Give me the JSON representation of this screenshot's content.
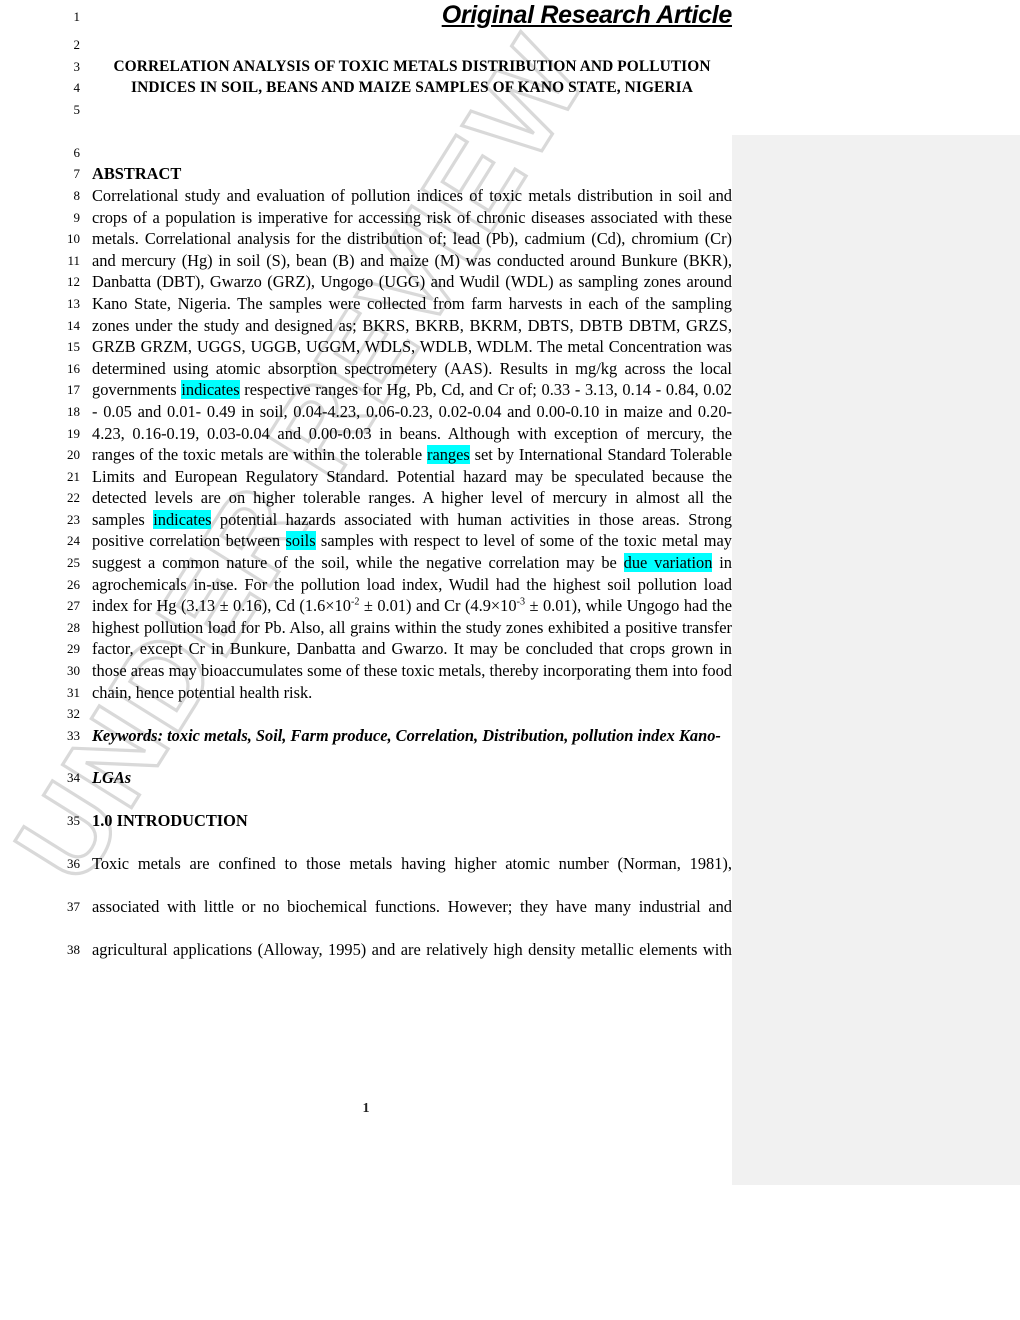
{
  "document": {
    "article_type": "Original Research Article",
    "title_lines": [
      "CORRELATION ANALYSIS OF TOXIC METALS DISTRIBUTION AND POLLUTION",
      "INDICES IN SOIL, BEANS AND MAIZE SAMPLES OF KANO STATE, NIGERIA"
    ],
    "abstract_heading": "ABSTRACT",
    "page_number": "1",
    "watermark_text": "UNDER REVIEW",
    "highlight_color": "#00ffff",
    "review_panel_color": "#f1f1f1"
  },
  "line_numbers": {
    "n1": "1",
    "n2": "2",
    "n3": "3",
    "n4": "4",
    "n5": "5",
    "n6": "6",
    "n7": "7",
    "n8": "8",
    "n9": "9",
    "n10": "10",
    "n11": "11",
    "n12": "12",
    "n13": "13",
    "n14": "14",
    "n15": "15",
    "n16": "16",
    "n17": "17",
    "n18": "18",
    "n19": "19",
    "n20": "20",
    "n21": "21",
    "n22": "22",
    "n23": "23",
    "n24": "24",
    "n25": "25",
    "n26": "26",
    "n27": "27",
    "n28": "28",
    "n29": "29",
    "n30": "30",
    "n31": "31",
    "n32": "32",
    "n33": "33",
    "n34": "34",
    "n35": "35",
    "n36": "36",
    "n37": "37",
    "n38": "38"
  },
  "abstract": {
    "l8": "Correlational study and evaluation of pollution indices of toxic metals distribution in soil and",
    "l9": "crops of a population is imperative for accessing risk of chronic diseases associated with these",
    "l10": "metals. Correlational analysis for the distribution of;  lead (Pb), cadmium (Cd), chromium (Cr)",
    "l11": "and mercury (Hg) in soil (S), bean (B) and maize (M) was conducted around Bunkure (BKR),",
    "l12": "Danbatta (DBT), Gwarzo (GRZ), Ungogo (UGG) and Wudil (WDL) as sampling zones around",
    "l13": "Kano State, Nigeria. The samples were collected from farm harvests in each of the sampling",
    "l14": "zones under the study and designed as;  BKRS, BKRB, BKRM, DBTS, DBTB DBTM, GRZS,",
    "l15": "GRZB GRZM, UGGS, UGGB, UGGM, WDLS, WDLB, WDLM. The metal Concentration was",
    "l16": "determined using atomic absorption spectrometery (AAS).  Results in mg/kg across the local",
    "l17_a": "governments ",
    "l17_hl": "indicates",
    "l17_b": " respective ranges for Hg, Pb, Cd, and Cr of; 0.33 - 3.13, 0.14 - 0.84, 0.02",
    "l18": "- 0.05 and 0.01- 0.49 in soil, 0.04-4.23, 0.06-0.23, 0.02-0.04 and 0.00-0.10 in maize and 0.20-",
    "l19": "4.23, 0.16-0.19, 0.03-0.04 and 0.00-0.03 in beans.  Although with exception of mercury, the",
    "l20_a": "ranges of the toxic metals are within the tolerable ",
    "l20_hl": "ranges",
    "l20_b": " set by International Standard Tolerable",
    "l21": "Limits and European Regulatory Standard. Potential hazard may be speculated because the",
    "l22": "detected levels are on higher tolerable ranges. A higher level of mercury in almost all the",
    "l23_a": "samples ",
    "l23_hl": "indicates",
    "l23_b": " potential hazards associated with human activities in those areas. Strong",
    "l24_a": "positive correlation between ",
    "l24_hl": "soils",
    "l24_b": " samples with respect to level of some of the toxic metal may",
    "l25_a": "suggest a common nature of the soil, while the negative correlation may be ",
    "l25_hl": "due variation",
    "l25_b": " in",
    "l26": "agrochemicals in-use. For the pollution load index, Wudil had the highest soil pollution load",
    "l27_a": "index for Hg (3.13 ± 0.16), Cd (1.6×10",
    "l27_sup1": "-2",
    "l27_b": " ± 0.01) and Cr (4.9×10",
    "l27_sup2": "-3",
    "l27_c": " ± 0.01), while Ungogo had the",
    "l28": "highest pollution load for Pb. Also, all grains within the study zones exhibited a positive transfer",
    "l29": "factor, except Cr in Bunkure, Danbatta and Gwarzo. It may be concluded that crops grown in",
    "l30": "those areas may bioaccumulates some of these toxic metals, thereby incorporating them into food",
    "l31": "chain, hence potential health risk."
  },
  "keywords": {
    "l33": "Keywords: toxic metals, Soil, Farm produce, Correlation, Distribution, pollution index Kano-",
    "l34": "LGAs"
  },
  "introduction": {
    "heading": "1.0 INTRODUCTION",
    "l36": "Toxic metals are confined to those metals having higher atomic number (Norman, 1981),",
    "l37": "associated with little or no biochemical functions. However; they have many industrial and",
    "l38": "agricultural applications (Alloway, 1995) and are relatively high density metallic elements with"
  }
}
